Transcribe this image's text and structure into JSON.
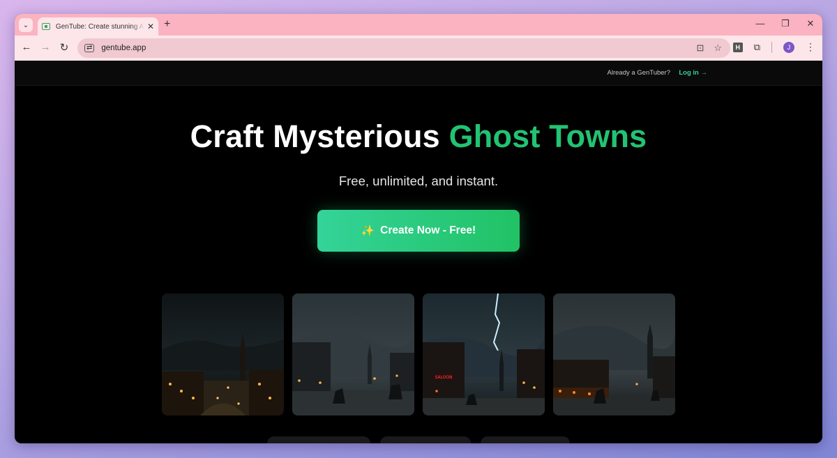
{
  "browser": {
    "tab_title": "GenTube: Create stunning AI art",
    "tab_close": "✕",
    "new_tab": "+",
    "url": "gentube.app",
    "profile_initial": "J",
    "extension_letter": "H",
    "controls": {
      "minimize": "—",
      "restore": "❐",
      "close": "✕"
    },
    "icons": {
      "back": "←",
      "forward": "→",
      "reload": "↻",
      "tab_search": "⌄",
      "install": "⊡",
      "star": "☆",
      "puzzle": "⧉",
      "menu": "⋮",
      "site_settings": "⇄"
    }
  },
  "header": {
    "already_text": "Already a GenTuber?",
    "login_label": "Log in →"
  },
  "hero": {
    "title_main": "Craft Mysterious ",
    "title_accent": "Ghost Towns",
    "subtitle": "Free, unlimited, and instant.",
    "cta_icon": "✨",
    "cta_label": "Create Now - Free!"
  },
  "gallery": {
    "card1_label": "",
    "card3_sign": "SALOON"
  },
  "colors": {
    "accent": "#22c372",
    "cta_start": "#34d399",
    "cta_end": "#21c265",
    "page_bg": "#000000"
  }
}
